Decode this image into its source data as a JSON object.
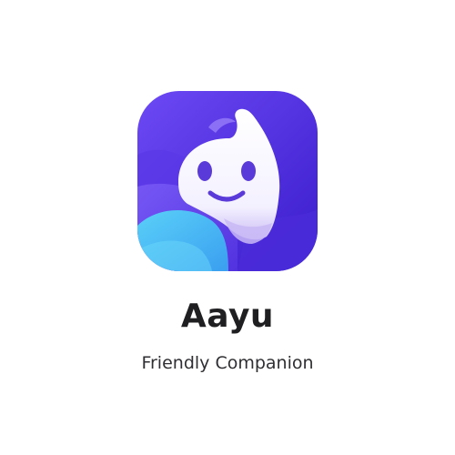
{
  "app": {
    "name": "Aayu",
    "tagline": "Friendly Companion",
    "icon": "smiling-ghost-mascot-icon"
  },
  "colors": {
    "background": "#ffffff",
    "icon_purple_light": "#6a45f2",
    "icon_purple_dark": "#3d1fcf",
    "wave_cyan": "#4fc2f5",
    "mascot_white": "#ffffff",
    "mascot_face": "#5a3ad8",
    "name_text": "#1f1f22",
    "tagline_text": "#2f2f33"
  }
}
